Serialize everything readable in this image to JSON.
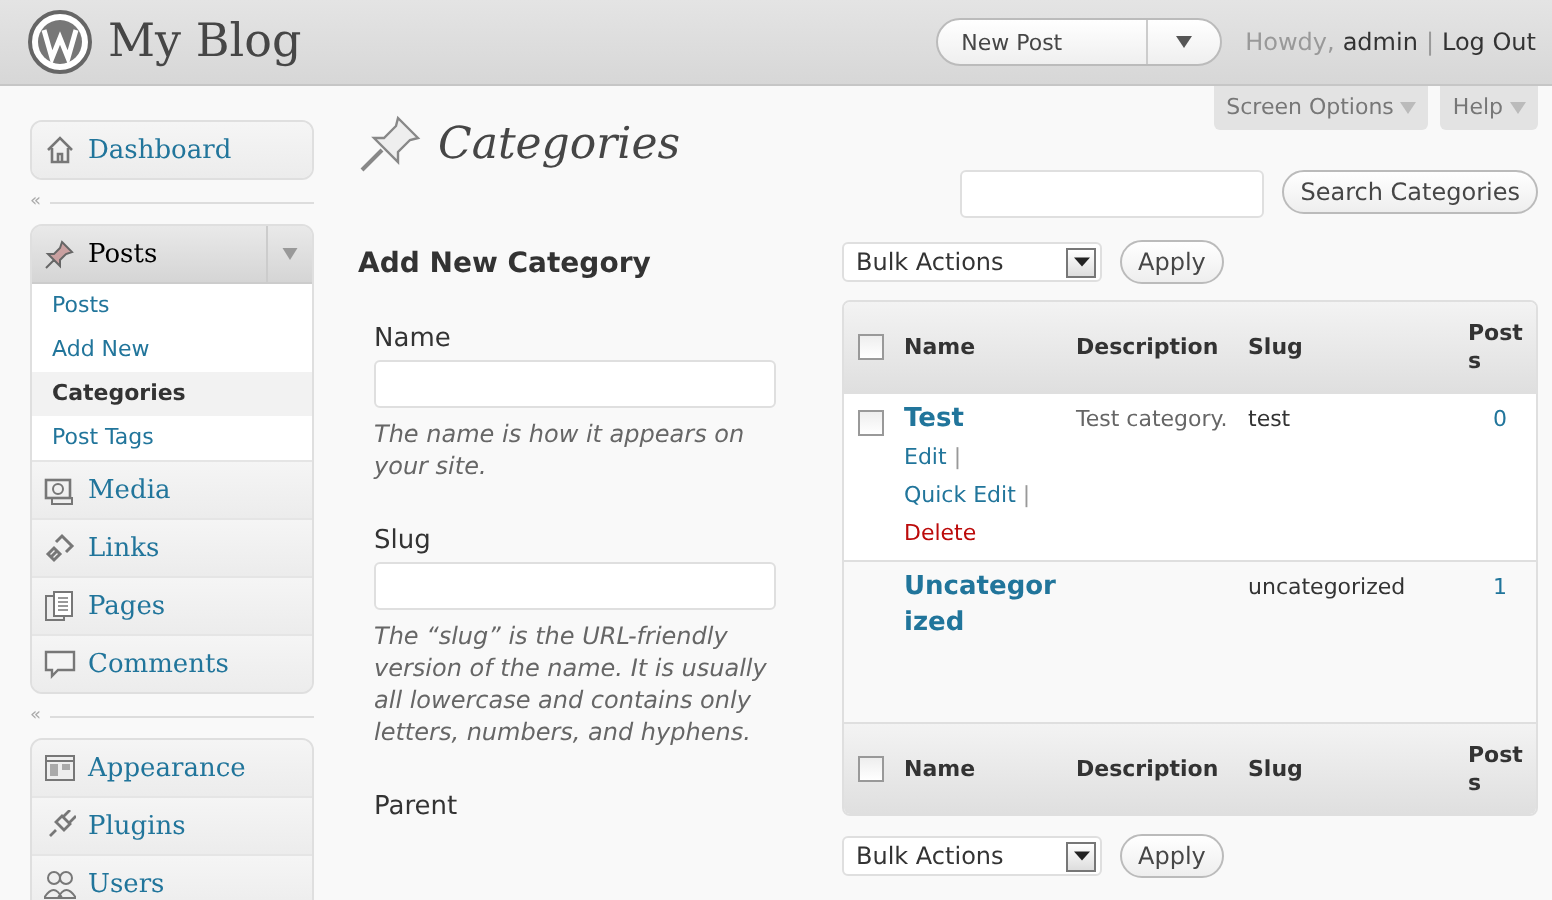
{
  "header": {
    "site_title": "My Blog",
    "new_post": "New Post",
    "greeting": "Howdy,",
    "user": "admin",
    "separator": "|",
    "logout": "Log Out"
  },
  "screen_tabs": [
    {
      "label": "Screen Options"
    },
    {
      "label": "Help"
    }
  ],
  "sidebar": {
    "groups": [
      {
        "items": [
          {
            "label": "Dashboard",
            "expanded": false
          }
        ]
      },
      {
        "separator": "«",
        "items": [
          {
            "label": "Posts",
            "expanded": true,
            "children": [
              {
                "label": "Posts",
                "selected": false
              },
              {
                "label": "Add New",
                "selected": false
              },
              {
                "label": "Categories",
                "selected": true
              },
              {
                "label": "Post Tags",
                "selected": false
              }
            ]
          },
          {
            "label": "Media",
            "expanded": false
          },
          {
            "label": "Links",
            "expanded": false
          },
          {
            "label": "Pages",
            "expanded": false
          },
          {
            "label": "Comments",
            "expanded": false
          }
        ]
      },
      {
        "separator": "«",
        "items": [
          {
            "label": "Appearance",
            "expanded": false
          },
          {
            "label": "Plugins",
            "expanded": false
          },
          {
            "label": "Users",
            "expanded": false
          }
        ]
      }
    ]
  },
  "page_title": "Categories",
  "search": {
    "button": "Search Categories"
  },
  "form": {
    "heading": "Add New Category",
    "fields": [
      {
        "label": "Name",
        "hint": "The name is how it appears on your site."
      },
      {
        "label": "Slug",
        "hint": "The “slug” is the URL-friendly version of the name. It is usually all lowercase and contains only letters, numbers, and hyphens."
      },
      {
        "label": "Parent"
      }
    ]
  },
  "bulk_top": {
    "value": "Bulk Actions",
    "button": "Apply"
  },
  "table": {
    "header_checked": false,
    "footer_checked": false,
    "columns": [
      "Name",
      "Description",
      "Slug",
      "Posts"
    ],
    "rows": [
      {
        "has_checkbox": true,
        "checked": false,
        "name": "Test",
        "actions": [
          {
            "label": "Edit",
            "kind": "normal",
            "separator": "|"
          },
          {
            "label": "Quick Edit",
            "kind": "normal",
            "separator": "|"
          },
          {
            "label": "Delete",
            "kind": "danger"
          }
        ],
        "description": "Test category.",
        "slug": "test",
        "posts": "0"
      },
      {
        "has_checkbox": false,
        "name": "Uncategorized",
        "description": "",
        "slug": "uncategorized",
        "posts": "1"
      }
    ],
    "footer_columns": [
      "Name",
      "Description",
      "Slug",
      "Posts"
    ]
  },
  "bulk_bottom": {
    "value": "Bulk Actions",
    "button": "Apply"
  }
}
